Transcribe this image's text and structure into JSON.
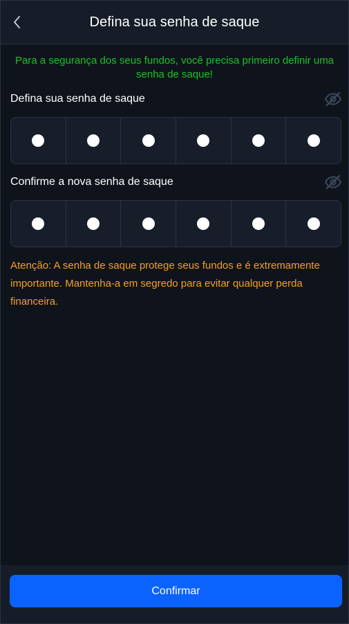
{
  "header": {
    "title": "Defina sua senha de saque",
    "back_icon": "chevron-left-icon"
  },
  "notice": "Para a segurança dos seus fundos, você precisa primeiro definir uma senha de saque!",
  "set_password": {
    "label": "Defina sua senha de saque",
    "eye_icon": "eye-off-icon",
    "digits_filled": 6,
    "digits_total": 6
  },
  "confirm_password": {
    "label": "Confirme a nova senha de saque",
    "eye_icon": "eye-off-icon",
    "digits_filled": 6,
    "digits_total": 6
  },
  "warning": "Atenção: A senha de saque protege seus fundos e é extremamente importante. Mantenha-a em segredo para evitar qualquer perda financeira.",
  "footer": {
    "confirm_label": "Confirmar"
  },
  "colors": {
    "background": "#0f141c",
    "panel": "#161d29",
    "notice_green": "#1ec226",
    "warning_orange": "#f5a021",
    "primary_blue": "#0a63ff"
  }
}
